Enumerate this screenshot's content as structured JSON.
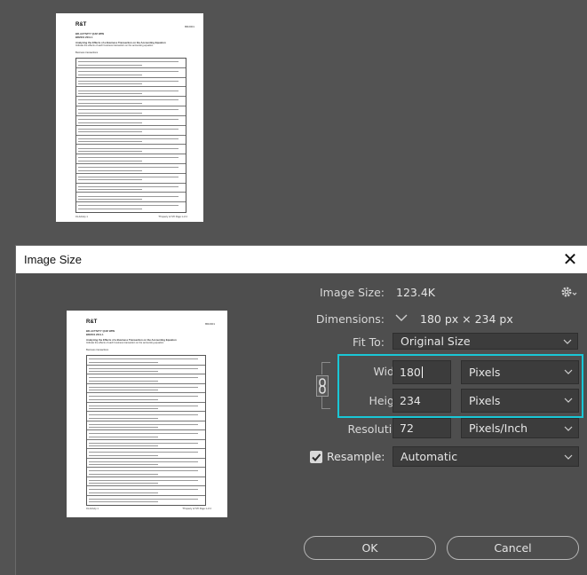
{
  "document": {
    "logo": "R&T",
    "id_label": "BR2001",
    "header_lines": [
      "BR-ACTIVITY QUIZ WPB",
      "BR2001 2011-1"
    ],
    "heading": "Analyzing the Effects of a Business Transaction on the Accounting Equation",
    "subheading": "Indicate the effects of each business transaction on the accounting equation.",
    "section_label": "Business transactions",
    "footer_left": "01 Activity 1",
    "footer_right": "*Property of STI  Page 1 of 2"
  },
  "dialog": {
    "title": "Image Size",
    "close_label": "✕",
    "image_size_label": "Image Size:",
    "image_size_value": "123.4K",
    "dimensions_label": "Dimensions:",
    "dimensions_value": "180 px  ×  234 px",
    "fit_to_label": "Fit To:",
    "fit_to_value": "Original Size",
    "width_label": "Width:",
    "width_value": "180",
    "width_unit": "Pixels",
    "height_label": "Height:",
    "height_value": "234",
    "height_unit": "Pixels",
    "resolution_label": "Resolution:",
    "resolution_value": "72",
    "resolution_unit": "Pixels/Inch",
    "resample_label": "Resample:",
    "resample_checked": true,
    "resample_value": "Automatic",
    "ok_label": "OK",
    "cancel_label": "Cancel"
  },
  "colors": {
    "canvas_bg": "#535353",
    "dialog_bg": "#4e4e4e",
    "highlight": "#19c7d6"
  },
  "icons": [
    "gear-icon",
    "chevron-down-icon",
    "link-icon",
    "close-icon",
    "checkmark-icon"
  ]
}
